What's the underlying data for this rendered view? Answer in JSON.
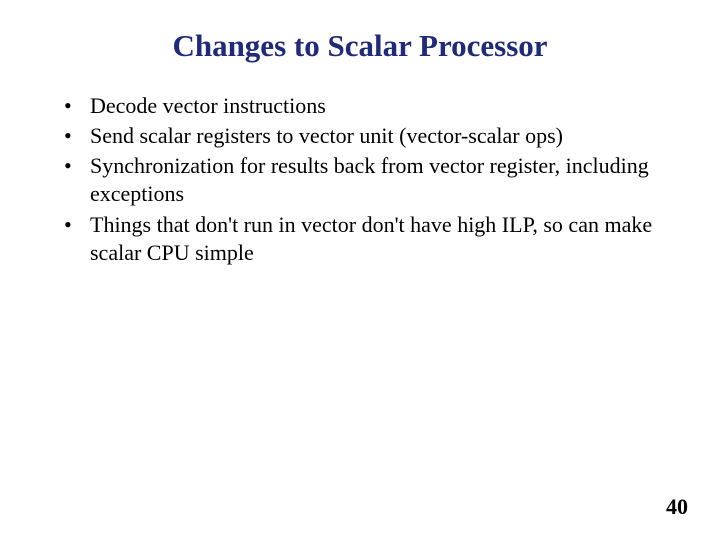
{
  "title": "Changes to Scalar Processor",
  "bullets": [
    "Decode vector instructions",
    "Send scalar registers to vector unit (vector-scalar ops)",
    "Synchronization for results back from vector register, including exceptions",
    "Things that don't run in vector don't have high ILP, so can make scalar CPU simple"
  ],
  "pageNumber": "40"
}
